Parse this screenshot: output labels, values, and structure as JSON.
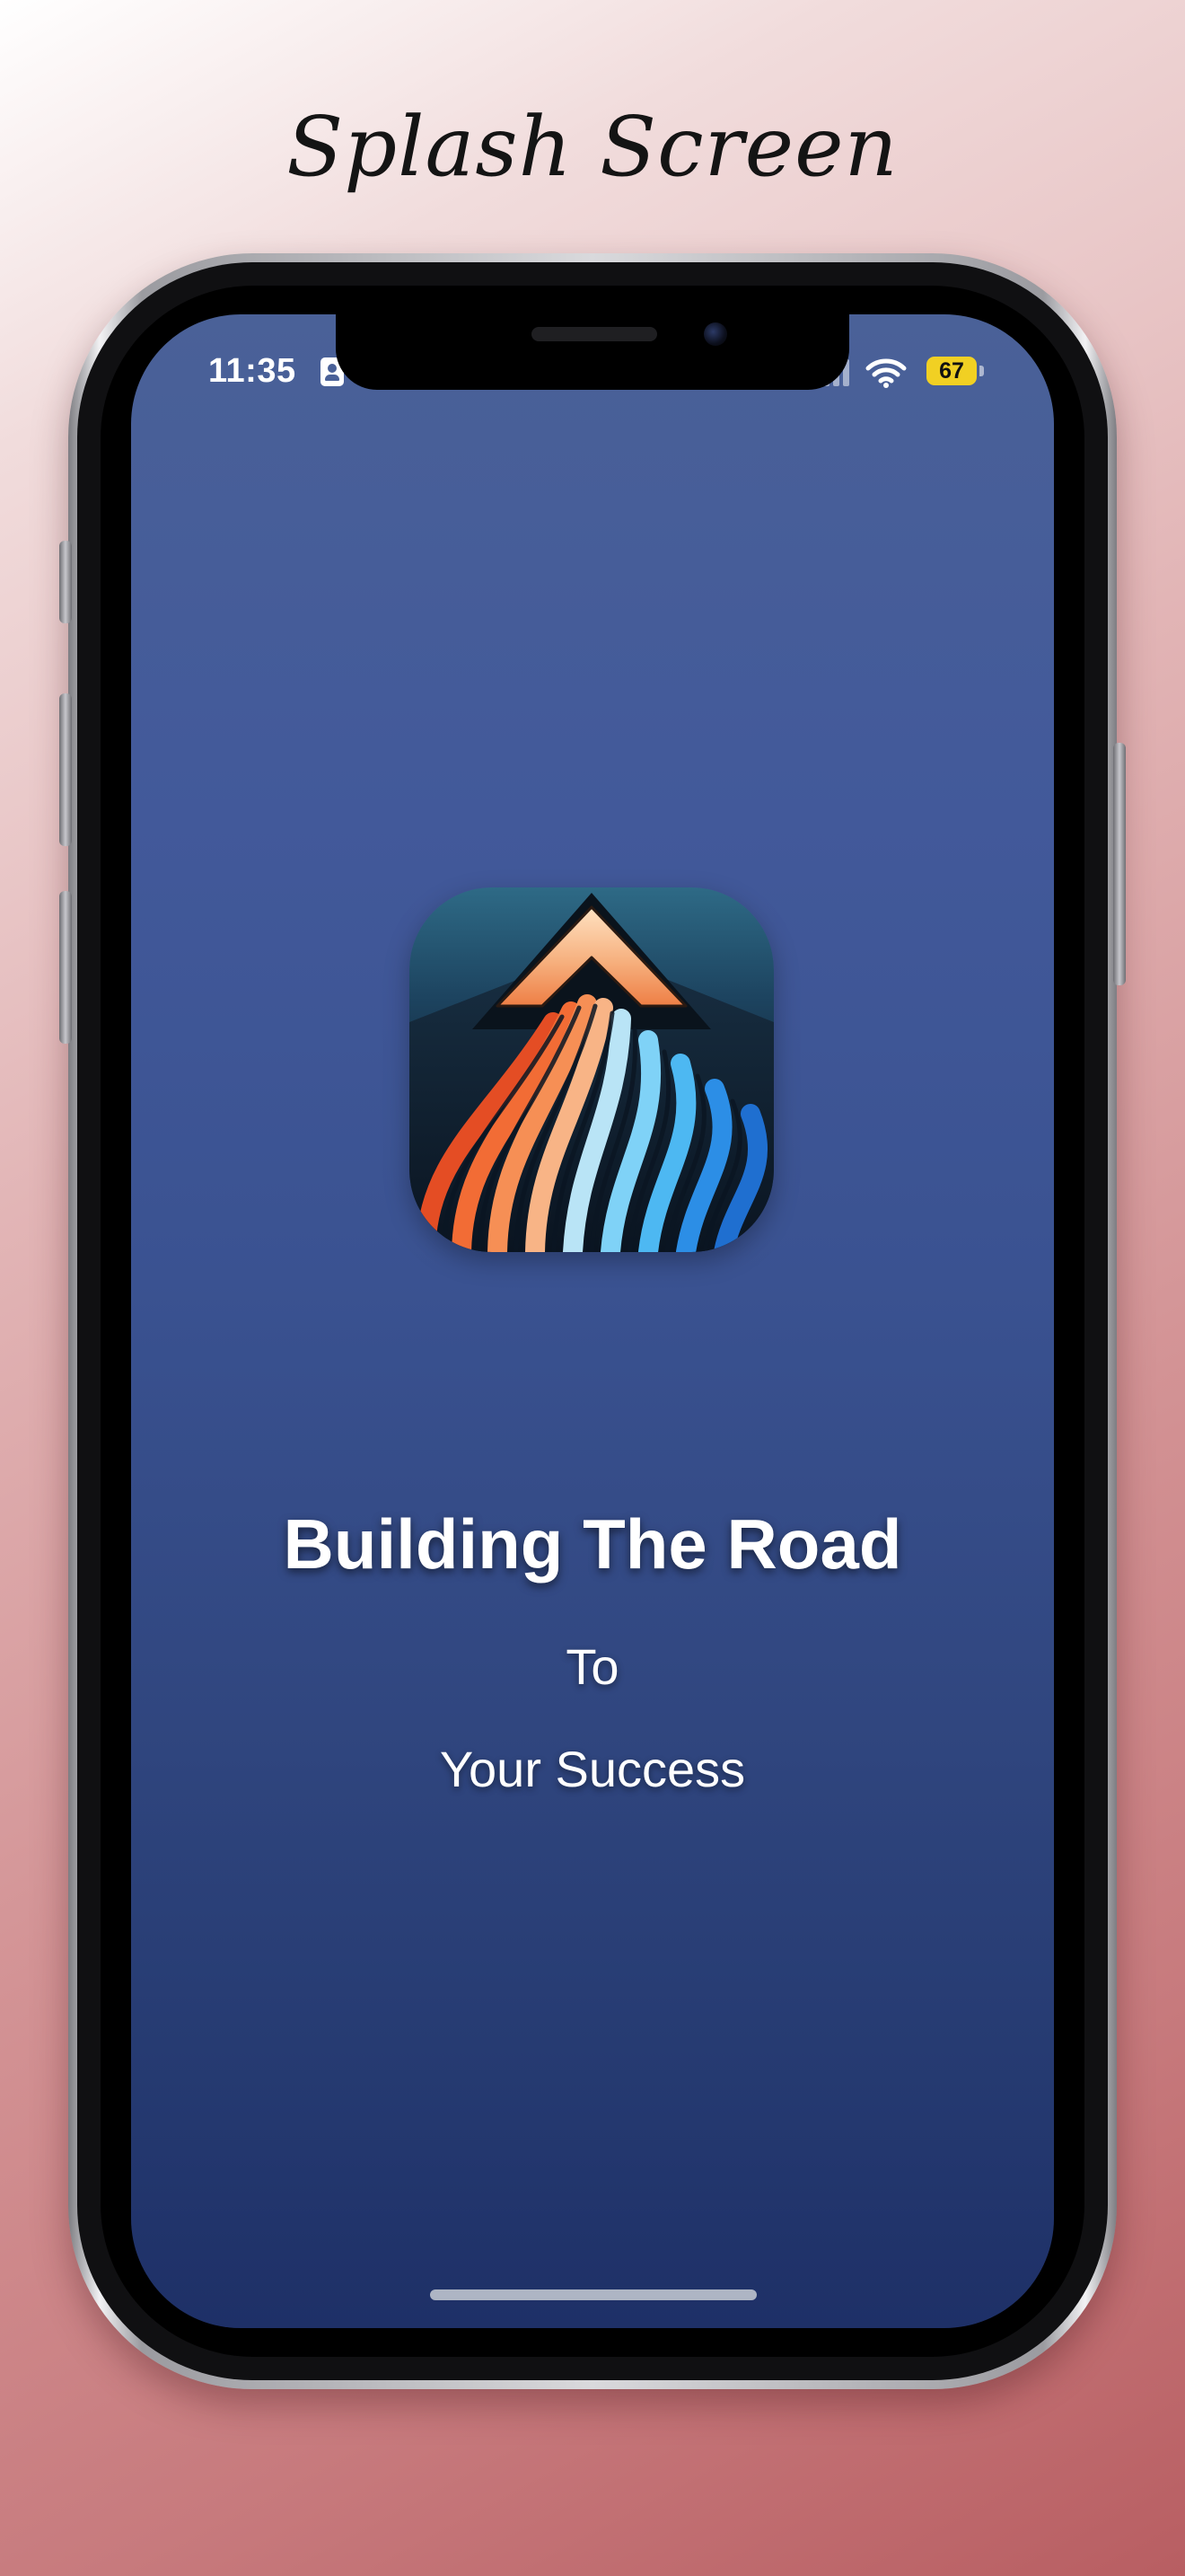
{
  "page": {
    "title": "Splash Screen"
  },
  "status_bar": {
    "time": "11:35",
    "battery_level": "67",
    "icons": [
      "contact-card-icon",
      "cellular-signal-icon",
      "wifi-icon",
      "battery-icon"
    ]
  },
  "splash": {
    "app_icon": "rising-road-arrow-icon",
    "headline": "Building The Road",
    "line_2": "To",
    "line_3": "Your Success"
  },
  "colors": {
    "screen_top": "#4a6198",
    "screen_bottom": "#1e3067",
    "battery_badge": "#f1d023",
    "stripe_orange": "#f26c35",
    "stripe_blue": "#3fa2ee"
  }
}
